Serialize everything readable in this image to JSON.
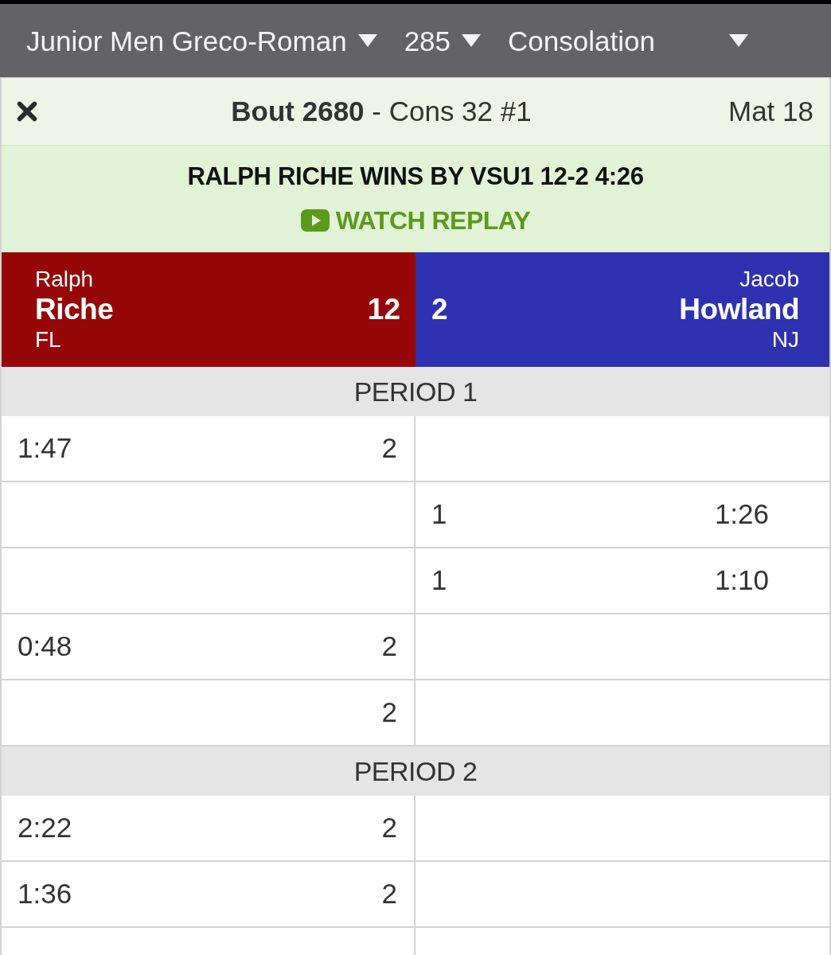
{
  "filters": [
    {
      "label": "Junior Men Greco-Roman"
    },
    {
      "label": "285"
    },
    {
      "label": "Consolation"
    }
  ],
  "bout": {
    "title": "**Bout 2680** - Cons 32 #1",
    "mat": "Mat 18"
  },
  "result": {
    "text": "RALPH RICHE WINS BY VSU1 12-2 4:26",
    "replay": "WATCH REPLAY"
  },
  "wrestlers": [
    {
      "first_name": "Ralph",
      "last_name": "Riche",
      "team": "FL",
      "score": "12",
      "color": "#960808"
    },
    {
      "first_name": "Jacob",
      "last_name": "Howland",
      "team": "NJ",
      "score": "2",
      "color": "#2e32b0"
    }
  ],
  "periods": [
    {
      "title": "PERIOD 1",
      "rows": [
        {
          "left": {
            "time": "1:47",
            "points": "2"
          }
        },
        {
          "right": {
            "points": "1",
            "time": "1:26"
          }
        },
        {
          "right": {
            "points": "1",
            "time": "1:10"
          }
        },
        {
          "left": {
            "time": "0:48",
            "points": "2"
          }
        },
        {
          "left": {
            "points": "2"
          }
        }
      ]
    },
    {
      "title": "PERIOD 2",
      "rows": [
        {
          "left": {
            "time": "2:22",
            "points": "2"
          }
        },
        {
          "left": {
            "time": "1:36",
            "points": "2"
          }
        }
      ]
    }
  ]
}
